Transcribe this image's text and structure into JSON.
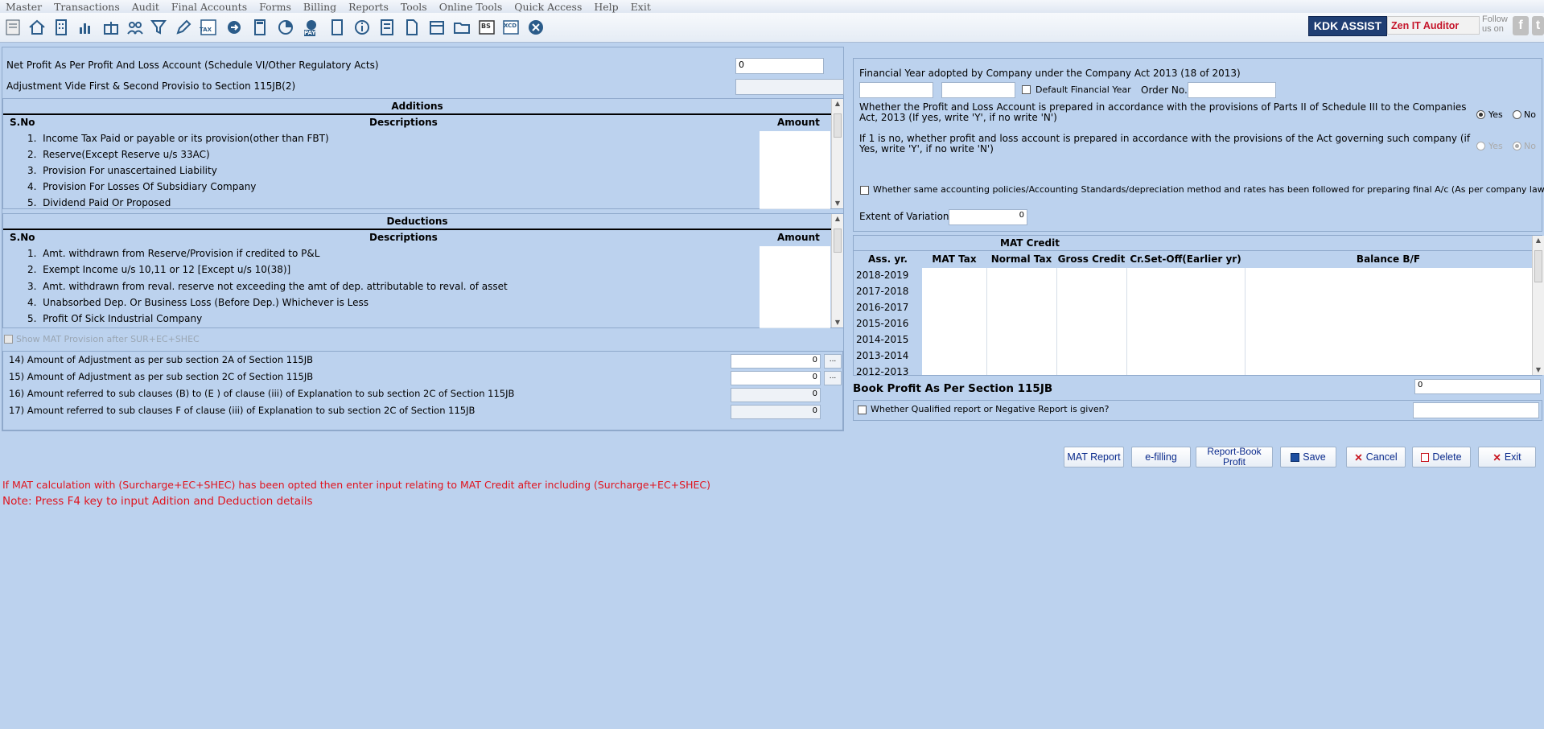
{
  "menu": [
    "Master",
    "Transactions",
    "Audit",
    "Final Accounts",
    "Forms",
    "Billing",
    "Reports",
    "Tools",
    "Online Tools",
    "Quick Access",
    "Help",
    "Exit"
  ],
  "toolbar": {
    "icons": [
      "form-icon",
      "home-icon",
      "building-icon",
      "chart-icon",
      "gift-icon",
      "users-icon",
      "filter-icon",
      "tax-icon",
      "pen-icon",
      "graph-icon",
      "calculator-icon",
      "pie-chart-icon",
      "pay-icon",
      "book-icon",
      "info-icon",
      "report-icon",
      "document-icon",
      "calendar-icon",
      "folder-add-icon",
      "bs-icon",
      "xcd-icon",
      "close-icon"
    ],
    "tax_label": "TAX",
    "pay_label": "PAY",
    "bs_label": "BS",
    "xcd_label": "XCD",
    "kdk_assist": "KDK ASSIST",
    "zen": "Zen IT Auditor",
    "follow": "Follow us on"
  },
  "left": {
    "net_profit_label": "Net Profit As Per Profit And Loss Account (Schedule VI/Other Regulatory Acts)",
    "net_profit_value": "0",
    "adjustment_label": "Adjustment Vide First & Second Provisio to Section 115JB(2)",
    "additions": {
      "title": "Additions",
      "col_sno": "S.No",
      "col_desc": "Descriptions",
      "col_amt": "Amount",
      "rows": [
        {
          "no": "1.",
          "desc": "Income Tax Paid or payable or its provision(other than FBT)"
        },
        {
          "no": "2.",
          "desc": "Reserve(Except Reserve u/s 33AC)"
        },
        {
          "no": "3.",
          "desc": "Provision For unascertained Liability"
        },
        {
          "no": "4.",
          "desc": "Provision For Losses Of Subsidiary Company"
        },
        {
          "no": "5.",
          "desc": "Dividend Paid Or Proposed"
        }
      ]
    },
    "deductions": {
      "title": "Deductions",
      "col_sno": "S.No",
      "col_desc": "Descriptions",
      "col_amt": "Amount",
      "rows": [
        {
          "no": "1.",
          "desc": "Amt. withdrawn from Reserve/Provision if credited to P&L"
        },
        {
          "no": "2.",
          "desc": "Exempt Income u/s 10,11 or 12 [Except u/s 10(38)]"
        },
        {
          "no": "3.",
          "desc": "Amt. withdrawn from reval. reserve not exceeding the amt of dep. attributable to reval. of asset"
        },
        {
          "no": "4.",
          "desc": "Unabsorbed Dep. Or Business Loss (Before Dep.) Whichever is Less"
        },
        {
          "no": "5.",
          "desc": "Profit Of Sick Industrial Company"
        }
      ]
    },
    "show_mat_label": "Show MAT Provision after SUR+EC+SHEC",
    "items": [
      {
        "label": "14)  Amount of Adjustment as per sub section 2A of Section 115JB",
        "value": "0",
        "btn": "..."
      },
      {
        "label": "15) Amount of Adjustment as per sub section 2C of Section 115JB",
        "value": "0",
        "btn": "..."
      },
      {
        "label": "16) Amount referred to sub clauses (B) to (E ) of clause (iii) of Explanation to sub section 2C of Section 115JB",
        "value": "0"
      },
      {
        "label": "17) Amount referred to sub clauses F of clause (iii) of Explanation to sub section 2C of Section 115JB",
        "value": "0"
      }
    ]
  },
  "right": {
    "fy_label": "Financial Year adopted by Company under the Company Act 2013 (18 of 2013)",
    "default_fy_label": "Default Financial Year",
    "order_no_label": "Order No.",
    "q1": "Whether the Profit and Loss Account is prepared in accordance with the provisions of Parts II of Schedule III to the Companies Act, 2013 (If yes, write 'Y', if no write 'N')",
    "q2": "If 1 is no, whether profit and loss account is prepared in accordance with the provisions of the Act governing such company (if Yes, write 'Y', if no write 'N')",
    "yes": "Yes",
    "no": "No",
    "policies_label": "Whether same accounting policies/Accounting Standards/depreciation method and  rates has been followed for preparing final A/c (As per company law)",
    "extent_label": "Extent of Variation",
    "extent_value": "0",
    "mat_credit": {
      "title": "MAT Credit",
      "columns": [
        "Ass. yr.",
        "MAT Tax",
        "Normal Tax",
        "Gross Credit",
        "Cr.Set-Off(Earlier yr)",
        "Balance B/F"
      ],
      "years": [
        "2018-2019",
        "2017-2018",
        "2016-2017",
        "2015-2016",
        "2014-2015",
        "2013-2014",
        "2012-2013"
      ]
    },
    "book_profit_label": "Book Profit As Per Section 115JB",
    "book_profit_value": "0",
    "qualified_label": "Whether Qualified report or Negative Report is given?"
  },
  "buttons": {
    "mat_report": "MAT Report",
    "efilling": "e-filling",
    "report_book_profit": "Report-Book Profit",
    "save": "Save",
    "cancel": "Cancel",
    "delete": "Delete",
    "exit": "Exit"
  },
  "notes": {
    "red1": "If MAT calculation with (Surcharge+EC+SHEC) has been opted then enter input relating to MAT Credit after including (Surcharge+EC+SHEC)",
    "red2": "Note: Press F4 key to input Adition and Deduction details"
  },
  "colors": {
    "background": "#bcd2ee",
    "note_red": "#e0141e",
    "button_text": "#0a2a8c",
    "kdk_bg": "#1f3e73"
  }
}
